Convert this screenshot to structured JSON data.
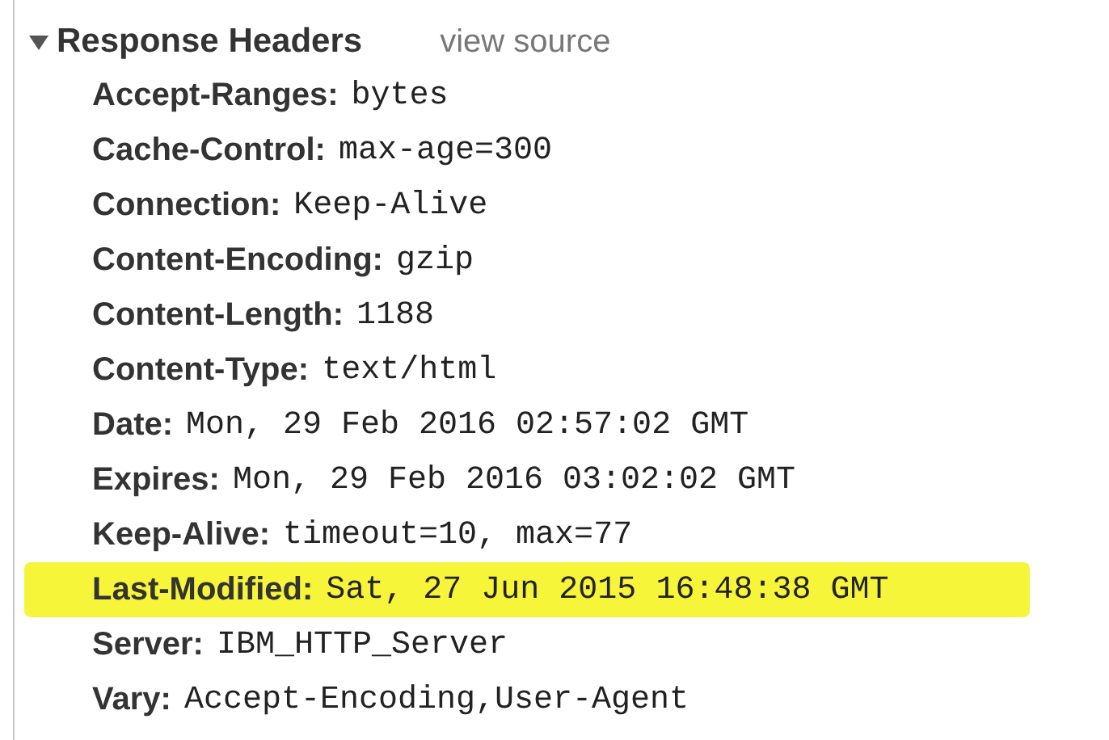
{
  "section": {
    "title": "Response Headers",
    "expanded": true,
    "link": "view source"
  },
  "headers": [
    {
      "name": "Accept-Ranges:",
      "value": "bytes",
      "highlighted": false
    },
    {
      "name": "Cache-Control:",
      "value": "max-age=300",
      "highlighted": false
    },
    {
      "name": "Connection:",
      "value": "Keep-Alive",
      "highlighted": false
    },
    {
      "name": "Content-Encoding:",
      "value": "gzip",
      "highlighted": false
    },
    {
      "name": "Content-Length:",
      "value": "1188",
      "highlighted": false
    },
    {
      "name": "Content-Type:",
      "value": "text/html",
      "highlighted": false
    },
    {
      "name": "Date:",
      "value": "Mon, 29 Feb 2016 02:57:02 GMT",
      "highlighted": false
    },
    {
      "name": "Expires:",
      "value": "Mon, 29 Feb 2016 03:02:02 GMT",
      "highlighted": false
    },
    {
      "name": "Keep-Alive:",
      "value": "timeout=10, max=77",
      "highlighted": false
    },
    {
      "name": "Last-Modified:",
      "value": "Sat, 27 Jun 2015 16:48:38 GMT",
      "highlighted": true
    },
    {
      "name": "Server:",
      "value": "IBM_HTTP_Server",
      "highlighted": false
    },
    {
      "name": "Vary:",
      "value": "Accept-Encoding,User-Agent",
      "highlighted": false
    }
  ]
}
